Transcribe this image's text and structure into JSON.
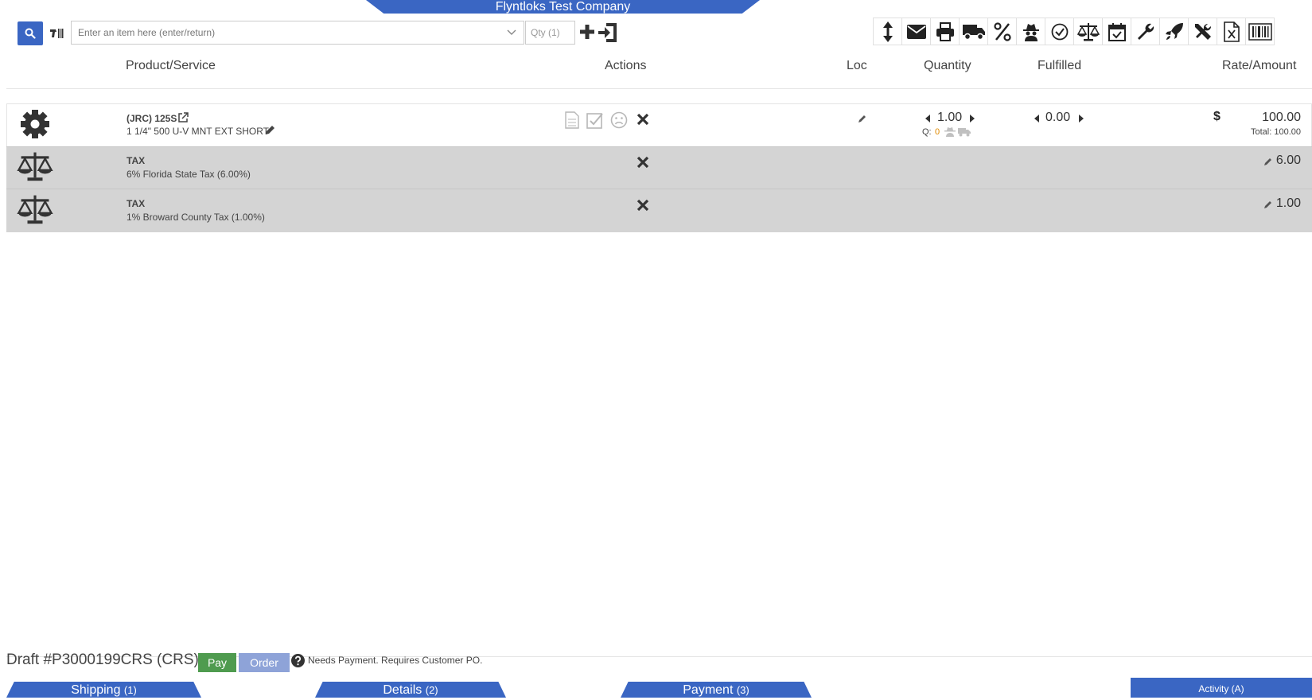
{
  "header": {
    "company": "Flyntloks Test Company"
  },
  "toolbar": {
    "item_placeholder": "Enter an item here (enter/return)",
    "qty_placeholder": "Qty (1)",
    "icons": [
      "resize-vertical-icon",
      "envelope-icon",
      "printer-icon",
      "truck-icon",
      "percent-icon",
      "spy-icon",
      "check-circle-icon",
      "scale-icon",
      "calendar-check-icon",
      "wrench-icon",
      "rocket-icon",
      "tools-icon",
      "excel-file-icon",
      "barcode-icon"
    ]
  },
  "columns": {
    "product": "Product/Service",
    "actions": "Actions",
    "loc": "Loc",
    "quantity": "Quantity",
    "fulfilled": "Fulfilled",
    "rate": "Rate/Amount"
  },
  "line_item": {
    "code": "(JRC)  125S",
    "description": "1 1/4\" 500 U-V MNT EXT SHORT",
    "quantity": "1.00",
    "q_label": "Q:",
    "q_value": "0",
    "fulfilled": "0.00",
    "currency": "$",
    "rate": "100.00",
    "total": "Total: 100.00"
  },
  "taxes": [
    {
      "type": "TAX",
      "description": "6% Florida State Tax (6.00%)",
      "amount": "6.00"
    },
    {
      "type": "TAX",
      "description": "1% Broward County Tax (1.00%)",
      "amount": "1.00"
    }
  ],
  "footer": {
    "draft_title": "Draft #P3000199CRS (CRS)",
    "pay_label": "Pay",
    "order_label": "Order",
    "status": "Needs Payment. Requires Customer PO.",
    "tabs": [
      {
        "label": "Shipping",
        "count": "(1)"
      },
      {
        "label": "Details",
        "count": "(2)"
      },
      {
        "label": "Payment",
        "count": "(3)"
      }
    ],
    "activity": "Activity (A)"
  },
  "colors": {
    "accent": "#3a66c3",
    "pay": "#4f9b4f",
    "order": "#8ea3d8",
    "tax_row": "#d4d4d4"
  }
}
